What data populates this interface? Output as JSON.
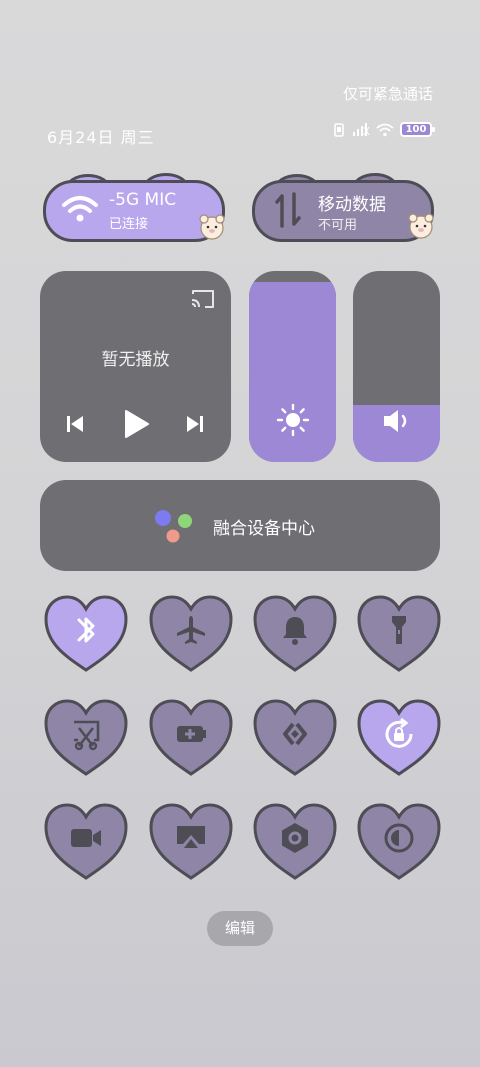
{
  "status_bar": {
    "emergency_text": "仅可紧急通话",
    "date_text": "6月24日 周三",
    "battery_level": "100",
    "icons": [
      "vibrate-icon",
      "signal-icon",
      "wifi-icon",
      "battery-icon"
    ]
  },
  "wifi_tile": {
    "ssid": "-5G MIC",
    "status": "已连接",
    "active": true
  },
  "mobile_tile": {
    "title": "移动数据",
    "status": "不可用",
    "active": false
  },
  "media": {
    "title": "暂无播放",
    "icons": [
      "cast-icon",
      "previous-icon",
      "play-icon",
      "next-icon"
    ]
  },
  "brightness": {
    "level": 0.94,
    "icon": "sun-icon"
  },
  "volume": {
    "level": 0.3,
    "icon": "speaker-icon"
  },
  "fusion": {
    "label": "融合设备中心"
  },
  "toggles": [
    {
      "icon": "bluetooth-icon",
      "active": true
    },
    {
      "icon": "airplane-icon",
      "active": false
    },
    {
      "icon": "bell-icon",
      "active": false
    },
    {
      "icon": "flashlight-icon",
      "active": false
    },
    {
      "icon": "screenshot-icon",
      "active": false
    },
    {
      "icon": "battery-saver-icon",
      "active": false
    },
    {
      "icon": "screen-share-icon",
      "active": false
    },
    {
      "icon": "rotation-lock-icon",
      "active": true
    },
    {
      "icon": "screen-record-icon",
      "active": false
    },
    {
      "icon": "airplay-icon",
      "active": false
    },
    {
      "icon": "nfc-icon",
      "active": false
    },
    {
      "icon": "dark-mode-icon",
      "active": false
    }
  ],
  "colors": {
    "active": "#b8a7ec",
    "inactive": "#8f86a7",
    "outline": "#4e4d55",
    "panel": "#6f6f73",
    "slider_fill": "#9d88d6"
  },
  "edit_button": {
    "label": "编辑"
  }
}
